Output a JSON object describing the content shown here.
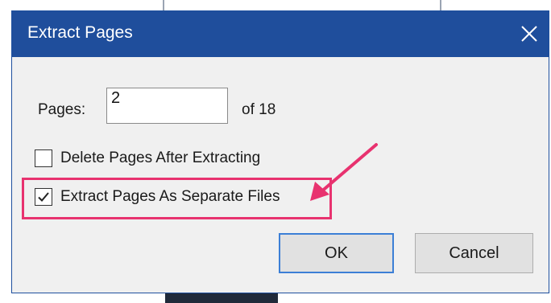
{
  "dialog": {
    "title": "Extract Pages",
    "close_icon": "close-icon"
  },
  "pages_field": {
    "label": "Pages:",
    "value": "2",
    "of_text": "of 18"
  },
  "options": [
    {
      "label": "Delete Pages After Extracting",
      "checked": false
    },
    {
      "label": "Extract Pages As Separate Files",
      "checked": true
    }
  ],
  "buttons": {
    "ok_label": "OK",
    "cancel_label": "Cancel"
  },
  "colors": {
    "titlebar": "#1f4e9c",
    "highlight": "#e8326f",
    "ok_border": "#3c7fd6"
  }
}
